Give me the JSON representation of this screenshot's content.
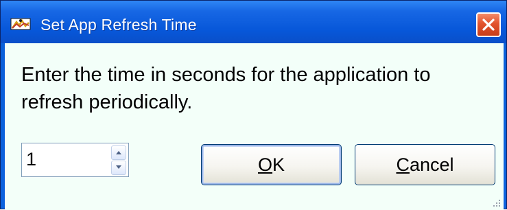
{
  "window": {
    "title": "Set App Refresh Time"
  },
  "dialog": {
    "message": "Enter the time in seconds for the application to refresh periodically.",
    "refresh_value": "1"
  },
  "buttons": {
    "ok_mnemonic": "O",
    "ok_rest": "K",
    "cancel_mnemonic": "C",
    "cancel_rest": "ancel"
  },
  "icons": {
    "app": "app-icon",
    "close": "close-icon",
    "spin_up": "spin-up-arrow-icon",
    "spin_down": "spin-down-arrow-icon",
    "grip": "resize-grip-icon"
  },
  "colors": {
    "titlebar": "#0757d9",
    "client_background": "#f3fff9",
    "close_button": "#e2532d",
    "button_border": "#003c74"
  }
}
